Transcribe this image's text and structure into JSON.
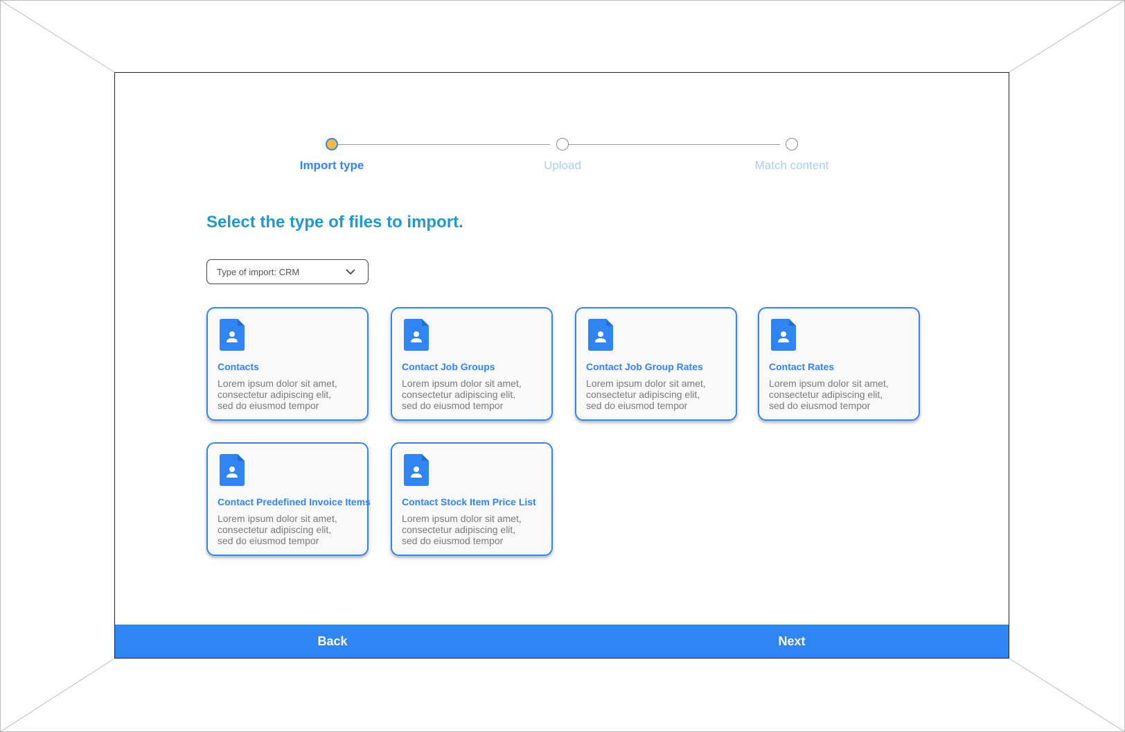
{
  "stepper": {
    "steps": [
      {
        "label": "Import type",
        "state": "active"
      },
      {
        "label": "Upload",
        "state": "inactive"
      },
      {
        "label": "Match content",
        "state": "inactive"
      }
    ]
  },
  "main": {
    "heading": "Select the type of files to import.",
    "import_type_select": {
      "value": "Type of import: CRM",
      "icon": "chevron-down-icon"
    },
    "cards": [
      {
        "title": "Contacts",
        "description": "Lorem ipsum dolor sit amet,\nconsectetur adipiscing elit,\nsed do eiusmod tempor",
        "icon": "contact-file-icon"
      },
      {
        "title": "Contact Job Groups",
        "description": "Lorem ipsum dolor sit amet,\nconsectetur adipiscing elit,\nsed do eiusmod tempor",
        "icon": "contact-file-icon"
      },
      {
        "title": "Contact Job Group Rates",
        "description": "Lorem ipsum dolor sit amet,\nconsectetur adipiscing elit,\nsed do eiusmod tempor",
        "icon": "contact-file-icon"
      },
      {
        "title": "Contact Rates",
        "description": "Lorem ipsum dolor sit amet,\nconsectetur adipiscing elit,\nsed do eiusmod tempor",
        "icon": "contact-file-icon"
      },
      {
        "title": "Contact Predefined Invoice Items",
        "description": "Lorem ipsum dolor sit amet,\nconsectetur adipiscing elit,\nsed do eiusmod tempor",
        "icon": "contact-file-icon"
      },
      {
        "title": "Contact Stock Item Price List",
        "description": "Lorem ipsum dolor sit amet,\nconsectetur adipiscing elit,\nsed do eiusmod tempor",
        "icon": "contact-file-icon"
      }
    ]
  },
  "footer": {
    "back_label": "Back",
    "next_label": "Next"
  },
  "colors": {
    "accent": "#2f86f3",
    "heading": "#1d9bd1",
    "active_step_dot": "#f9b93d",
    "inactive_step_label": "#a9cdf6",
    "card_background": "#f9f9f9"
  }
}
